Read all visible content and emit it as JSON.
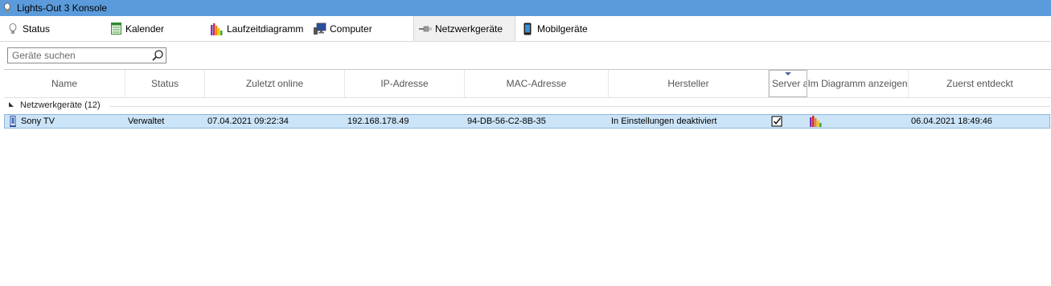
{
  "window": {
    "title": "Lights-Out 3 Konsole"
  },
  "tabs": [
    {
      "id": "status",
      "label": "Status",
      "icon": "lightbulb-icon"
    },
    {
      "id": "kalender",
      "label": "Kalender",
      "icon": "calendar-icon"
    },
    {
      "id": "laufzeit",
      "label": "Laufzeitdiagramm",
      "icon": "bar-chart-icon"
    },
    {
      "id": "computer",
      "label": "Computer",
      "icon": "computer-icon"
    },
    {
      "id": "netzwerk",
      "label": "Netzwerkgeräte",
      "icon": "network-cable-icon",
      "active": true
    },
    {
      "id": "mobil",
      "label": "Mobilgeräte",
      "icon": "smartphone-icon"
    }
  ],
  "search": {
    "placeholder": "Geräte suchen",
    "value": ""
  },
  "columns": [
    {
      "id": "name",
      "label": "Name"
    },
    {
      "id": "status",
      "label": "Status"
    },
    {
      "id": "zuletzt",
      "label": "Zuletzt online"
    },
    {
      "id": "ip",
      "label": "IP-Adresse"
    },
    {
      "id": "mac",
      "label": "MAC-Adresse"
    },
    {
      "id": "hersteller",
      "label": "Hersteller"
    },
    {
      "id": "server",
      "label": "Server a",
      "sorted": true
    },
    {
      "id": "diagramm",
      "label": "Im Diagramm anzeigen"
    },
    {
      "id": "entdeckt",
      "label": "Zuerst entdeckt"
    }
  ],
  "group": {
    "label": "Netzwerkgeräte (12)"
  },
  "rows": [
    {
      "name": "Sony TV",
      "status": "Verwaltet",
      "zuletzt": "07.04.2021 09:22:34",
      "ip": "192.168.178.49",
      "mac": "94-DB-56-C2-8B-35",
      "hersteller": "In Einstellungen deaktiviert",
      "server": true,
      "diagramm": true,
      "entdeckt": "06.04.2021 18:49:46"
    }
  ],
  "colors": {
    "titlebar": "#5b9bdc",
    "selection": "#cce4f7"
  }
}
